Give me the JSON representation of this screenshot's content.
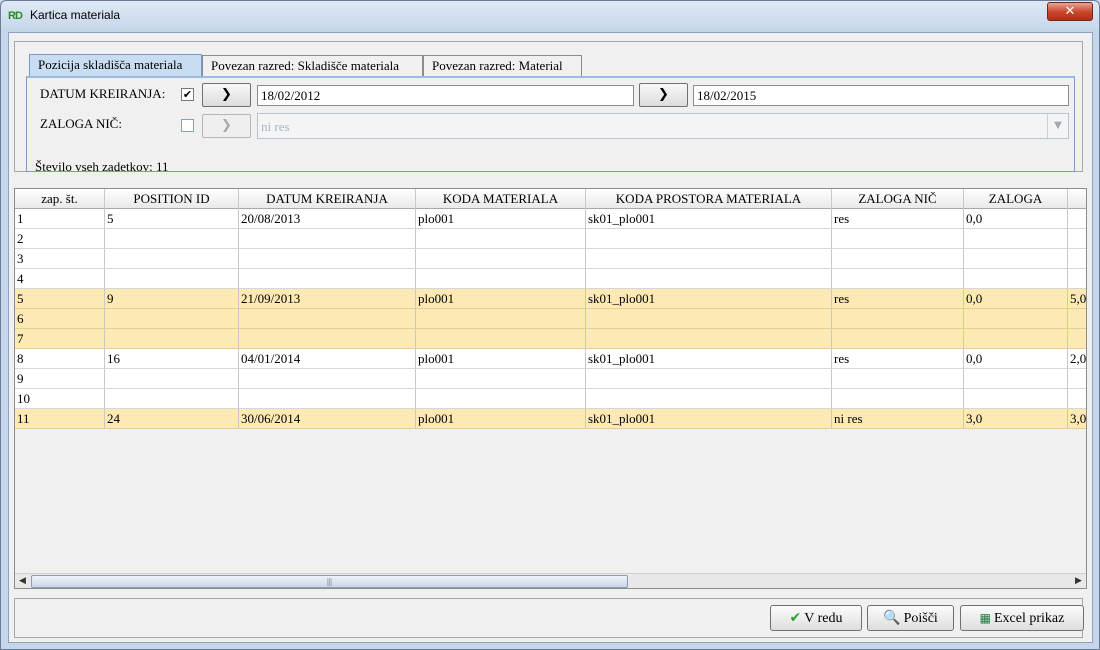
{
  "window": {
    "title": "Kartica materiala",
    "app_icon": "rd-logo-icon",
    "close_glyph": "✕"
  },
  "tabs": [
    {
      "label": "Pozicija skladišča materiala",
      "active": true
    },
    {
      "label": "Povezan razred: Skladišče materiala",
      "active": false
    },
    {
      "label": "Povezan razred: Material",
      "active": false
    }
  ],
  "filters": {
    "datum": {
      "label": "DATUM KREIRANJA:",
      "checked": true,
      "check_glyph": "✔",
      "from": "18/02/2012",
      "to": "18/02/2015",
      "go_glyph": "❯"
    },
    "zaloga": {
      "label": "ZALOGA NIČ:",
      "checked": false,
      "value": "ni res",
      "go_glyph": "❯",
      "dropdown_glyph": "▼"
    }
  },
  "record_count_text": "Število vseh zadetkov: 11",
  "table": {
    "columns": [
      "zap. št.",
      "POSITION ID",
      "DATUM KREIRANJA",
      "KODA MATERIALA",
      "KODA PROSTORA MATERIALA",
      "ZALOGA NIČ",
      "ZALOGA",
      ""
    ],
    "rows": [
      {
        "cells": [
          "1",
          "5",
          "20/08/2013",
          "plo001",
          "sk01_plo001",
          "res",
          "0,0",
          ""
        ],
        "highlight": false
      },
      {
        "cells": [
          "2",
          "",
          "",
          "",
          "",
          "",
          "",
          ""
        ],
        "highlight": false
      },
      {
        "cells": [
          "3",
          "",
          "",
          "",
          "",
          "",
          "",
          ""
        ],
        "highlight": false
      },
      {
        "cells": [
          "4",
          "",
          "",
          "",
          "",
          "",
          "",
          ""
        ],
        "highlight": false
      },
      {
        "cells": [
          "5",
          "9",
          "21/09/2013",
          "plo001",
          "sk01_plo001",
          "res",
          "0,0",
          "5,0"
        ],
        "highlight": true
      },
      {
        "cells": [
          "6",
          "",
          "",
          "",
          "",
          "",
          "",
          ""
        ],
        "highlight": true
      },
      {
        "cells": [
          "7",
          "",
          "",
          "",
          "",
          "",
          "",
          ""
        ],
        "highlight": true
      },
      {
        "cells": [
          "8",
          "16",
          "04/01/2014",
          "plo001",
          "sk01_plo001",
          "res",
          "0,0",
          "2,0"
        ],
        "highlight": false
      },
      {
        "cells": [
          "9",
          "",
          "",
          "",
          "",
          "",
          "",
          ""
        ],
        "highlight": false
      },
      {
        "cells": [
          "10",
          "",
          "",
          "",
          "",
          "",
          "",
          ""
        ],
        "highlight": false
      },
      {
        "cells": [
          "11",
          "24",
          "30/06/2014",
          "plo001",
          "sk01_plo001",
          "ni res",
          "3,0",
          "3,0"
        ],
        "highlight": true
      }
    ]
  },
  "scrollbar": {
    "left_glyph": "◀",
    "right_glyph": "▶",
    "grip_glyph": "|||"
  },
  "buttons": {
    "ok": {
      "label": "V redu",
      "icon": "checkmark-icon",
      "glyph": "✔"
    },
    "search": {
      "label": "Poišči",
      "icon": "magnifier-icon",
      "glyph": "🔍"
    },
    "excel": {
      "label": "Excel prikaz",
      "icon": "excel-icon",
      "glyph": "▦"
    }
  },
  "colors": {
    "highlight_row": "#fde9b4",
    "active_tab": "#c9ddf2",
    "title_gradient": "#c6d6ea"
  }
}
